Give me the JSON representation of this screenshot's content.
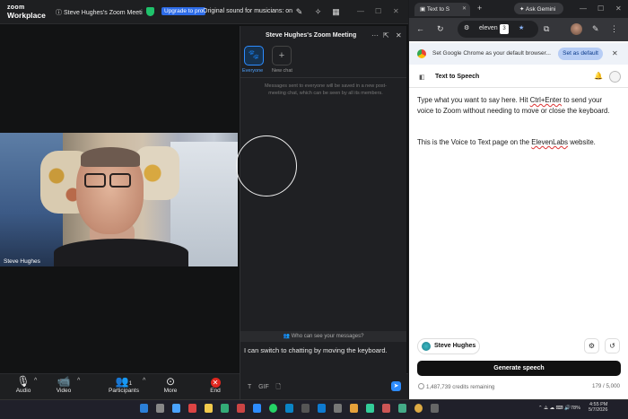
{
  "zoom": {
    "logo_line1": "zoom",
    "logo_line2": "Workplace",
    "meeting_tab": "Steve Hughes's Zoom Meeti",
    "upgrade_label": "Upgrade to pro",
    "sound_label": "Original sound for musicians: on",
    "participant_name": "Steve Hughes",
    "toolbar": {
      "audio": "Audio",
      "video": "Video",
      "participants": "Participants",
      "participants_count": "1",
      "more": "More",
      "end": "End"
    }
  },
  "chat": {
    "title": "Steve Hughes's Zoom Meeting",
    "everyone": "Everyone",
    "new_chat": "New chat",
    "notice": "Messages sent to everyone will be saved in a new post-meeting chat, which can be seen by all its members.",
    "who_can_see": "Who can see your messages?",
    "input_value": "I can switch to chatting by moving the keyboard.",
    "gif_label": "GIF"
  },
  "chrome": {
    "tab_title": "Text to S",
    "ask_gemini": "Ask Gemini",
    "address": "eleven",
    "extension_badge": "3",
    "banner_text": "Set Google Chrome as your default browser...",
    "set_default": "Set as default",
    "page_heading": "Text to Speech",
    "para1_a": "Type what you want to say here. Hit ",
    "para1_key": "Ctrl+Enter",
    "para1_b": " to send your voice to Zoom without needing to move or close the keyboard.",
    "para2_a": "This is the Voice to Text page on the ",
    "para2_brand": "ElevenLabs",
    "para2_b": " website.",
    "voice_name": "Steve Hughes",
    "generate_label": "Generate speech",
    "credits": "1,487,739 credits remaining",
    "char_count": "179 / 5,000"
  },
  "taskbar": {
    "temp": "78%",
    "time": "4:55 PM",
    "date": "5/7/2026"
  },
  "colors": {
    "zoom_blue": "#2d8cff",
    "end_red": "#e0271f",
    "shield_green": "#1fc26b"
  }
}
